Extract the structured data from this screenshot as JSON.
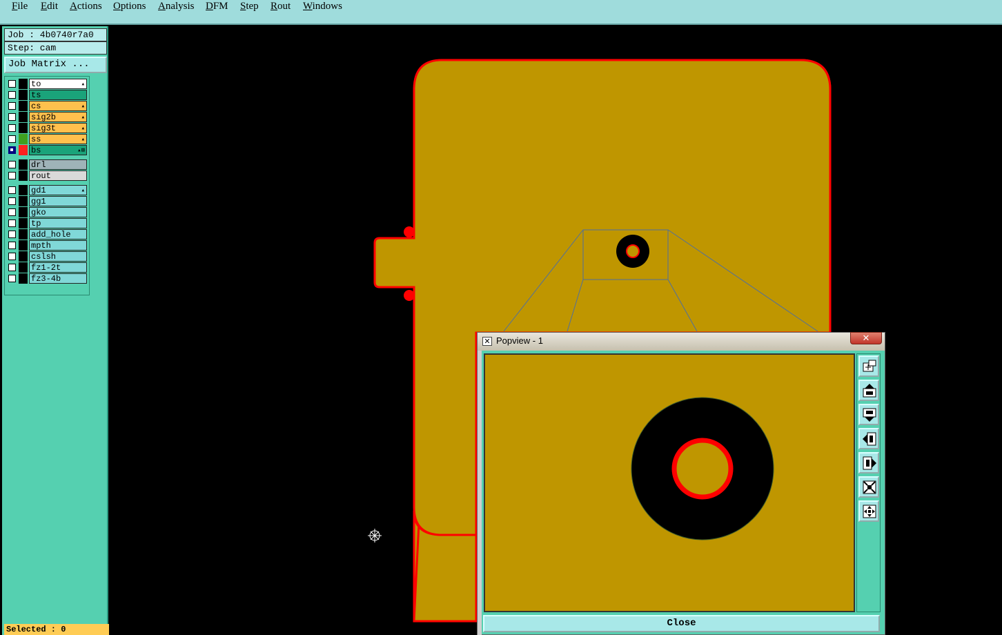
{
  "menu": [
    "File",
    "Edit",
    "Actions",
    "Options",
    "Analysis",
    "DFM",
    "Step",
    "Rout",
    "Windows"
  ],
  "job": {
    "label": "Job : 4b0740r7a0",
    "step": "Step: cam",
    "matrix_button": "Job Matrix ..."
  },
  "layers": [
    {
      "name": "to",
      "color": "#ffffff",
      "tag": "▴",
      "swatch": "#000000",
      "selected": false
    },
    {
      "name": "ts",
      "color": "#1aa37a",
      "tag": "",
      "swatch": "#000000",
      "selected": false
    },
    {
      "name": "cs",
      "color": "#ffc04d",
      "tag": "▴",
      "swatch": "#000000",
      "selected": false
    },
    {
      "name": "sig2b",
      "color": "#ffc04d",
      "tag": "▴",
      "swatch": "#000000",
      "selected": false
    },
    {
      "name": "sig3t",
      "color": "#ffc04d",
      "tag": "▴",
      "swatch": "#000000",
      "selected": false
    },
    {
      "name": "ss",
      "color": "#ffc04d",
      "tag": "▴",
      "swatch": "#3f9f1f",
      "selected": false
    },
    {
      "name": "bs",
      "color": "#1aa37a",
      "tag": "▴⊞",
      "swatch": "#ff2020",
      "selected": true
    },
    {
      "name": "drl",
      "color": "#9fb3b8",
      "tag": "",
      "swatch": "#000000",
      "selected": false
    },
    {
      "name": "rout",
      "color": "#d9d9d9",
      "tag": "",
      "swatch": "#000000",
      "selected": false
    },
    {
      "name": "gd1",
      "color": "#80d8d8",
      "tag": "▴",
      "swatch": "#000000",
      "selected": false
    },
    {
      "name": "gg1",
      "color": "#80d8d8",
      "tag": "",
      "swatch": "#000000",
      "selected": false
    },
    {
      "name": "gko",
      "color": "#80d8d8",
      "tag": "",
      "swatch": "#000000",
      "selected": false
    },
    {
      "name": "tp",
      "color": "#80d8d8",
      "tag": "",
      "swatch": "#000000",
      "selected": false
    },
    {
      "name": "add_hole",
      "color": "#80d8d8",
      "tag": "",
      "swatch": "#000000",
      "selected": false
    },
    {
      "name": "mpth",
      "color": "#80d8d8",
      "tag": "",
      "swatch": "#000000",
      "selected": false
    },
    {
      "name": "cslsh",
      "color": "#80d8d8",
      "tag": "",
      "swatch": "#000000",
      "selected": false
    },
    {
      "name": "fz1-2t",
      "color": "#80d8d8",
      "tag": "",
      "swatch": "#000000",
      "selected": false
    },
    {
      "name": "fz3-4b",
      "color": "#80d8d8",
      "tag": "",
      "swatch": "#000000",
      "selected": false
    }
  ],
  "status": "Selected : 0",
  "popview": {
    "title": "Popview - 1",
    "close_label": "Close",
    "tool_icons": [
      "popview-icon",
      "move-up-icon",
      "move-down-icon",
      "move-left-icon",
      "move-right-icon",
      "zoom-fit-icon",
      "zoom-center-icon"
    ]
  },
  "colors": {
    "board": "#bf9600",
    "outline": "#ff0000",
    "pad": "#000000",
    "window_line": "#4f6f9f",
    "panel": "#55d0b0",
    "menubar": "#9fdcdc"
  }
}
